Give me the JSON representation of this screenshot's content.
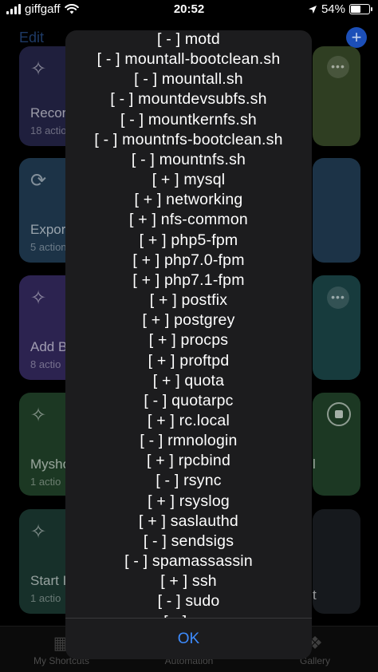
{
  "status_bar": {
    "carrier": "giffgaff",
    "time": "20:52",
    "battery": "54%",
    "battery_level": 0.54
  },
  "nav": {
    "edit_label": "Edit",
    "add_label": "+"
  },
  "tiles": [
    {
      "title": "Recor",
      "subtitle": "18 actio",
      "color": "#3a3a6e"
    },
    {
      "title": "",
      "subtitle": "",
      "color": "#3d4f2a"
    },
    {
      "title": "Expor",
      "subtitle": "5 action",
      "color": "#244660"
    },
    {
      "title": "",
      "subtitle": "",
      "color": "#244660"
    },
    {
      "title": "Add B",
      "subtitle": "8 actio",
      "color": "#3e2f6a"
    },
    {
      "title": "",
      "subtitle": "",
      "color": "#1d4f52"
    },
    {
      "title": "Mysho",
      "subtitle": "1 actio",
      "color": "#26472f"
    },
    {
      "title": "l",
      "subtitle": "",
      "color": "#26472f"
    },
    {
      "title": "Start I",
      "subtitle": "1 actio",
      "color": "#1f3d34"
    },
    {
      "title": "t",
      "subtitle": "",
      "color": "#1f2329"
    }
  ],
  "tab_bar": {
    "my_shortcuts": "My Shortcuts",
    "automation": "Automation",
    "gallery": "Gallery"
  },
  "alert": {
    "lines": [
      "[ - ]  motd",
      "[ - ]  mountall-bootclean.sh",
      "[ - ]  mountall.sh",
      "[ - ]  mountdevsubfs.sh",
      "[ - ]  mountkernfs.sh",
      "[ - ]  mountnfs-bootclean.sh",
      "[ - ]  mountnfs.sh",
      "[ + ]  mysql",
      "[ + ]  networking",
      "[ + ]  nfs-common",
      "[ + ]  php5-fpm",
      "[ + ]  php7.0-fpm",
      "[ + ]  php7.1-fpm",
      "[ + ]  postfix",
      "[ + ]  postgrey",
      "[ + ]  procps",
      "[ + ]  proftpd",
      "[ + ]  quota",
      "[ - ]  quotarpc",
      "[ + ]  rc.local",
      "[ - ]  rmnologin",
      "[ + ]  rpcbind",
      "[ - ]  rsync",
      "[ + ]  rsyslog",
      "[ + ]  saslauthd",
      "[ - ]  sendsigs",
      "[ - ]  spamassassin",
      "[ + ]  ssh",
      "[ - ]  sudo",
      "[ - ]  u..."
    ],
    "ok_label": "OK"
  }
}
